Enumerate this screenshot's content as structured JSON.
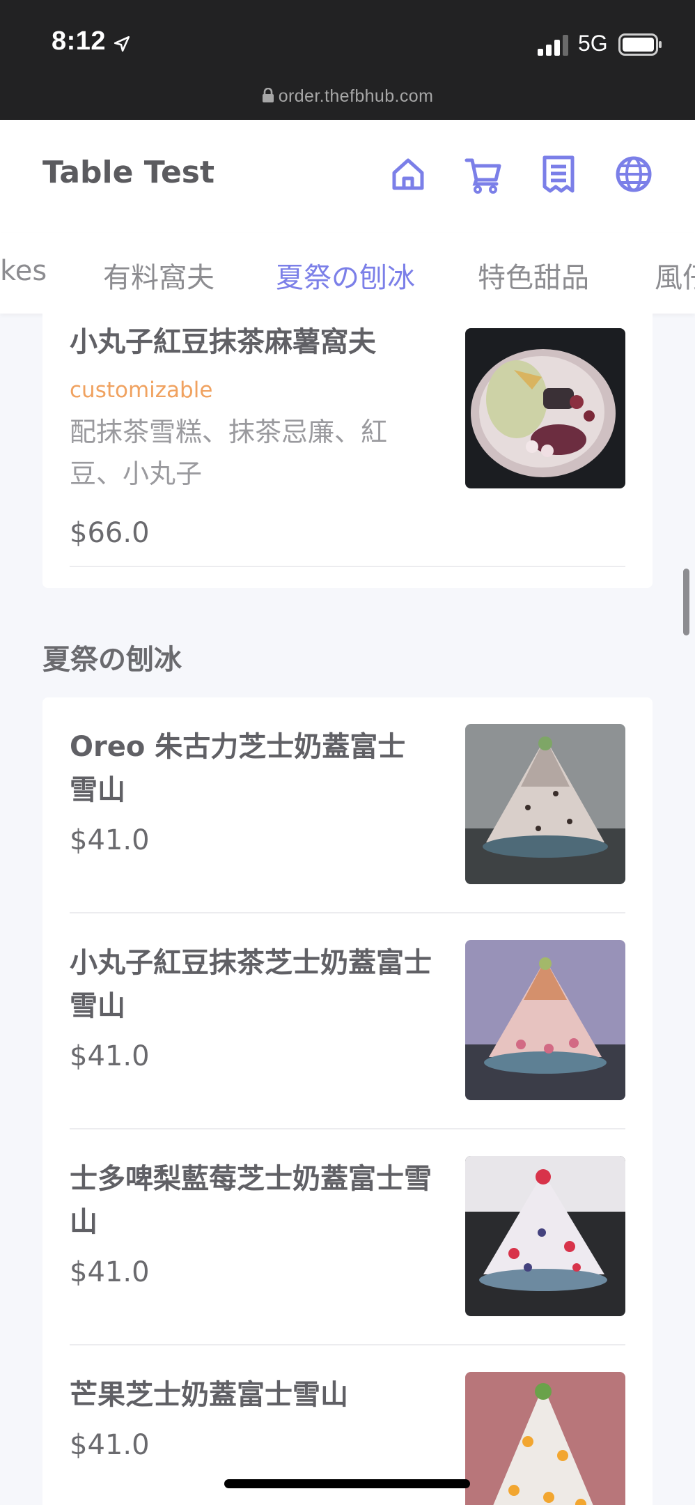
{
  "status_bar": {
    "time": "8:12",
    "network": "5G",
    "url": "order.thefbhub.com"
  },
  "header": {
    "title": "Table Test",
    "icons": [
      "home-icon",
      "cart-icon",
      "receipt-icon",
      "globe-icon"
    ]
  },
  "tabs": [
    {
      "label": "kes",
      "active": false
    },
    {
      "label": "有料窩夫",
      "active": false
    },
    {
      "label": "夏祭の刨冰",
      "active": true
    },
    {
      "label": "特色甜品",
      "active": false
    },
    {
      "label": "風仔",
      "active": false
    }
  ],
  "top_item": {
    "name": "小丸子紅豆抹茶麻薯窩夫",
    "tag": "customizable",
    "description": "配抹茶雪糕、抹茶忌廉、紅豆、小丸子",
    "price": "$66.0"
  },
  "section": {
    "title": "夏祭の刨冰",
    "items": [
      {
        "name": "Oreo 朱古力芝士奶蓋富士雪山",
        "price": "$41.0"
      },
      {
        "name": "小丸子紅豆抹茶芝士奶蓋富士雪山",
        "price": "$41.0"
      },
      {
        "name": "士多啤梨藍莓芝士奶蓋富士雪山",
        "price": "$41.0"
      },
      {
        "name": "芒果芝士奶蓋富士雪山",
        "price": "$41.0"
      }
    ]
  },
  "colors": {
    "accent": "#7b7fe8",
    "tag": "#f0a260",
    "status_bar": "#222223",
    "background": "#f6f7fb"
  }
}
